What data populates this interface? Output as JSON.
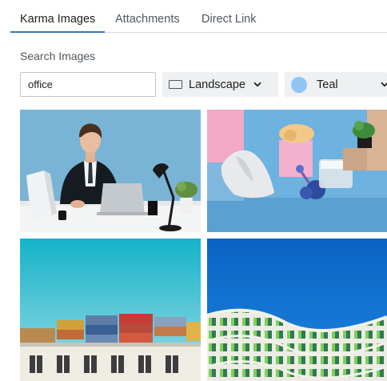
{
  "tabs": [
    {
      "label": "Karma Images",
      "active": true
    },
    {
      "label": "Attachments",
      "active": false
    },
    {
      "label": "Direct Link",
      "active": false
    }
  ],
  "search": {
    "label": "Search Images",
    "value": "office"
  },
  "filters": {
    "orientation": {
      "selected": "Landscape",
      "icon": "landscape-icon"
    },
    "color": {
      "selected": "Teal",
      "swatch": "#8ec5f5"
    }
  },
  "accent_color": "#3a78b8",
  "images": [
    {
      "name": "businessman-at-desk"
    },
    {
      "name": "still-life-blue"
    },
    {
      "name": "shipping-containers"
    },
    {
      "name": "green-building-facade"
    }
  ]
}
